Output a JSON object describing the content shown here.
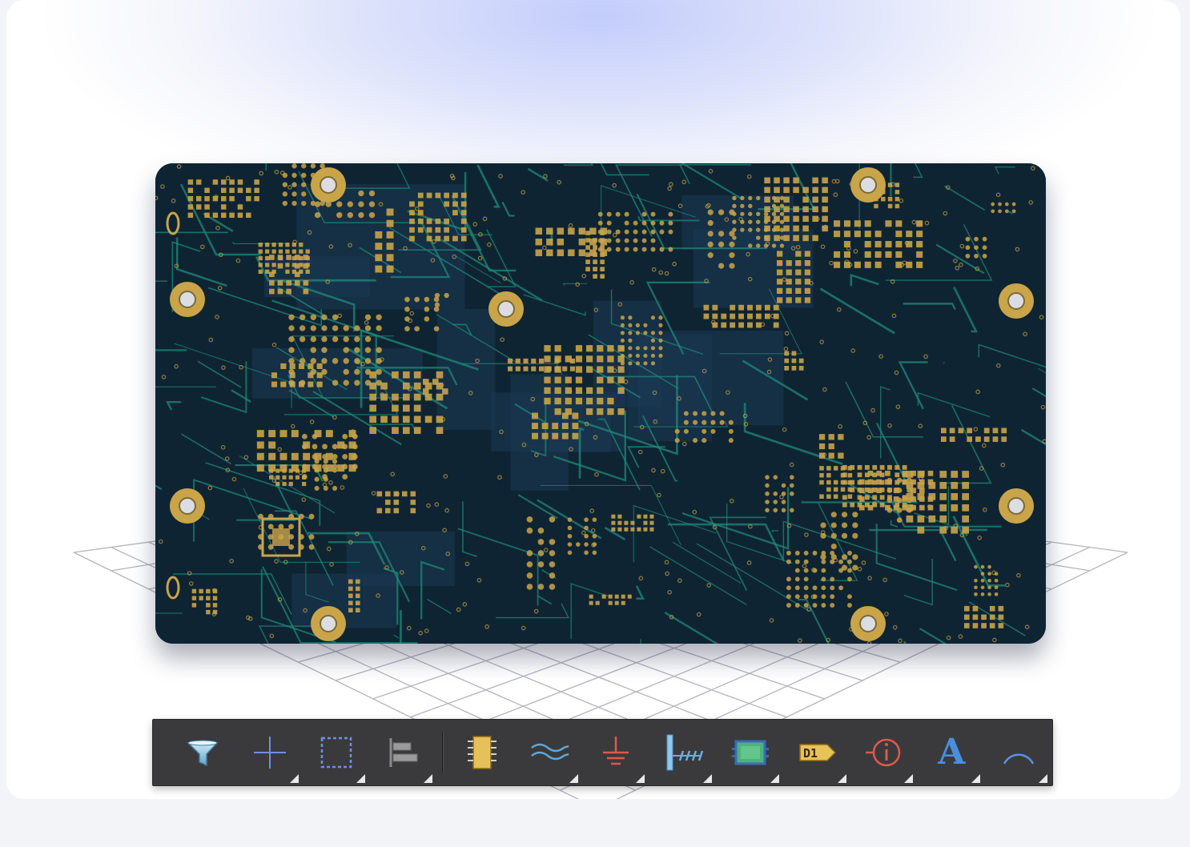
{
  "scene": {
    "board_name": "",
    "colors": {
      "board": "#0f2432",
      "copper": "#c9a449",
      "trace": "#1d8a7a",
      "toolbar": "#3a3a3c"
    }
  },
  "toolbar": {
    "tools": [
      {
        "name": "filter-tool",
        "icon": "filter-icon",
        "has_submenu": false
      },
      {
        "name": "cross-tool",
        "icon": "crosshair-icon",
        "has_submenu": true
      },
      {
        "name": "select-area-tool",
        "icon": "dashed-rectangle-icon",
        "has_submenu": true
      },
      {
        "name": "align-tool",
        "icon": "align-left-icon",
        "has_submenu": true
      },
      {
        "name": "component-tool",
        "icon": "chip-icon",
        "has_submenu": false
      },
      {
        "name": "diff-pair-tool",
        "icon": "waves-icon",
        "has_submenu": true
      },
      {
        "name": "ground-tool",
        "icon": "ground-icon",
        "has_submenu": true
      },
      {
        "name": "bus-tool",
        "icon": "bus-icon",
        "has_submenu": true
      },
      {
        "name": "sheet-tool",
        "icon": "sheet-symbol-icon",
        "has_submenu": true
      },
      {
        "name": "port-tool",
        "icon": "port-icon",
        "has_submenu": true
      },
      {
        "name": "probe-tool",
        "icon": "probe-icon",
        "has_submenu": true
      },
      {
        "name": "text-tool",
        "icon": "text-icon",
        "has_submenu": true
      },
      {
        "name": "arc-tool",
        "icon": "arc-icon",
        "has_submenu": true
      }
    ],
    "port_label": "D1",
    "text_label": "A"
  }
}
